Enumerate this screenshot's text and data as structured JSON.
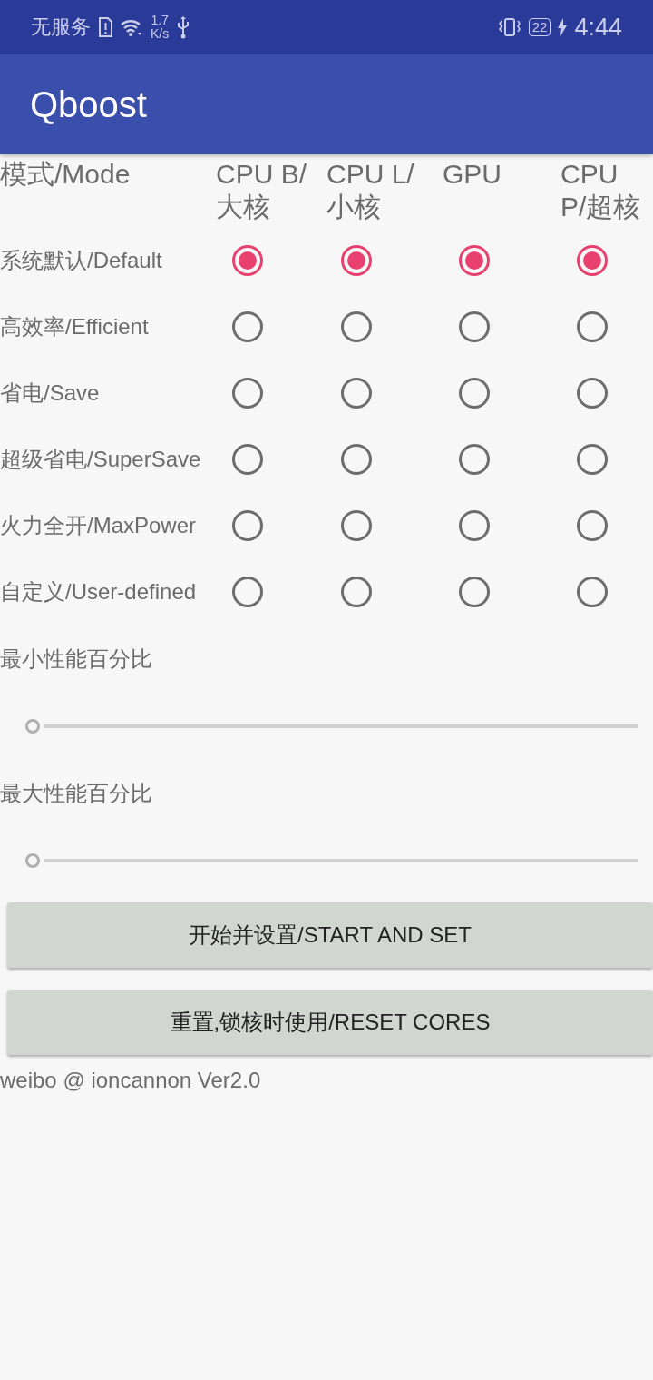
{
  "status_bar": {
    "carrier": "无服务",
    "speed_value": "1.7",
    "speed_unit": "K/s",
    "battery": "22",
    "time": "4:44"
  },
  "app_bar": {
    "title": "Qboost"
  },
  "mode_table": {
    "corner": "模式/Mode",
    "columns": [
      "CPU B/大核",
      "CPU L/小核",
      "GPU",
      "CPU P/超核"
    ],
    "rows": [
      {
        "label": "系统默认/Default",
        "choices": [
          {
            "selected": true
          },
          {
            "selected": true
          },
          {
            "selected": true
          },
          {
            "selected": true
          }
        ]
      },
      {
        "label": "高效率/Efficient",
        "choices": [
          {
            "selected": false
          },
          {
            "selected": false
          },
          {
            "selected": false
          },
          {
            "selected": false
          }
        ]
      },
      {
        "label": "省电/Save",
        "choices": [
          {
            "selected": false
          },
          {
            "selected": false
          },
          {
            "selected": false
          },
          {
            "selected": false
          }
        ]
      },
      {
        "label": "超级省电/SuperSave",
        "choices": [
          {
            "selected": false
          },
          {
            "selected": false
          },
          {
            "selected": false
          },
          {
            "selected": false
          }
        ]
      },
      {
        "label": "火力全开/MaxPower",
        "choices": [
          {
            "selected": false
          },
          {
            "selected": false
          },
          {
            "selected": false
          },
          {
            "selected": false
          }
        ]
      },
      {
        "label": "自定义/User-defined",
        "choices": [
          {
            "selected": false
          },
          {
            "selected": false
          },
          {
            "selected": false
          },
          {
            "selected": false
          }
        ]
      }
    ]
  },
  "sliders": [
    {
      "label": "最小性能百分比",
      "level": 0
    },
    {
      "label": "最大性能百分比",
      "level": 0
    }
  ],
  "buttons": [
    "开始并设置/START AND SET",
    "重置,锁核时使用/RESET CORES"
  ],
  "footer": "weibo @ ioncannon Ver2.0"
}
